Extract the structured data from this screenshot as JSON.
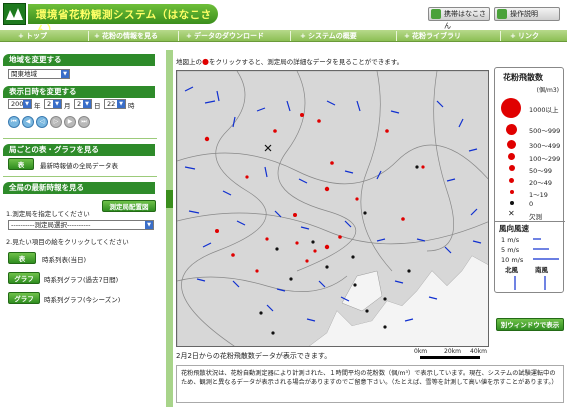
{
  "header": {
    "title": "環境省花粉観測システム（はなこさん）",
    "btn_hanako": "携帯はなこさん",
    "btn_help": "操作説明"
  },
  "nav": {
    "items": [
      "トップ",
      "花粉の情報を見る",
      "データのダウンロード",
      "システムの概要",
      "花粉ライブラリ",
      "リンク"
    ]
  },
  "sidebar": {
    "region_head": "地域を変更する",
    "region_value": "関東地域",
    "datetime_head": "表示日時を変更する",
    "year": "2009",
    "year_unit": "年",
    "month": "2",
    "month_unit": "月",
    "day": "2",
    "day_unit": "日",
    "hour": "22",
    "hour_unit": "時",
    "station_head": "局ごとの表・グラフを見る",
    "table_btn": "表",
    "table_label": "最新時報値の全局データ表",
    "latest_head": "全局の最新時報を見る",
    "step1": "1.測定局を指定してください",
    "station_btn": "測定局配置図",
    "station_select": "----------測定局選択----------",
    "step2": "2.見たい項目の絵をクリックしてください",
    "opt1_btn": "表",
    "opt1_label": "時系列表(当日)",
    "opt2_btn": "グラフ",
    "opt2_label": "時系列グラフ(過去7日間)",
    "opt3_btn": "グラフ",
    "opt3_label": "時系列グラフ(今シーズン)"
  },
  "map": {
    "instruction_pre": "地図上の",
    "instruction_post": "をクリックすると、測定局の詳細なデータを見ることができます。",
    "caption": "2月2日からの花粉飛散数データが表示できます。",
    "scale_labels": [
      "0km",
      "20km",
      "40km"
    ]
  },
  "legend": {
    "title": "花粉飛散数",
    "unit": "(個/m3)",
    "rows": [
      {
        "label": "1000以上"
      },
      {
        "label": "500～999"
      },
      {
        "label": "300～499"
      },
      {
        "label": "100～299"
      },
      {
        "label": "50～99"
      },
      {
        "label": "20～49"
      },
      {
        "label": "1～19"
      },
      {
        "label": "0"
      },
      {
        "label": "欠測"
      }
    ],
    "wind_title": "風向風速",
    "wind_rows": [
      "1 m/s",
      "5 m/s",
      "10 m/s"
    ],
    "north_label": "北風",
    "south_label": "南風",
    "window_btn": "別ウィンドウで表示"
  },
  "note": {
    "text": "花粉飛散状況は、花粉自動測定器により計測された、１時間平均の花粉数（個/m³）で表示しています。現在、システムの試験運転中のため、観測と異なるデータが表示される場合がありますのでご留意下さい。（たとえば、雪等を計測して高い値を示すことがあります。）"
  },
  "colors": {
    "brand_green": "#2e8b2a",
    "pollen_red": "#e00000",
    "wind_blue": "#1030d0"
  }
}
